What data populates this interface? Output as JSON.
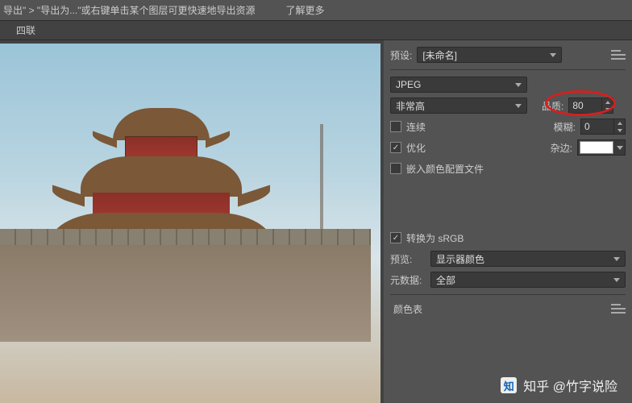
{
  "topbar": {
    "breadcrumb": "导出\" > \"导出为...\"或右键单击某个图层可更快速地导出资源",
    "learn_more": "了解更多"
  },
  "tab": {
    "label": "四联"
  },
  "panel": {
    "preset": {
      "label": "预设:",
      "value": "[未命名]"
    },
    "format": {
      "value": "JPEG"
    },
    "quality_preset": {
      "value": "非常高"
    },
    "quality": {
      "label": "品质:",
      "value": "80"
    },
    "progressive": {
      "label": "连续",
      "checked": false
    },
    "blur": {
      "label": "模糊:",
      "value": "0"
    },
    "optimized": {
      "label": "优化",
      "checked": true
    },
    "matte": {
      "label": "杂边:"
    },
    "embed_profile": {
      "label": "嵌入颜色配置文件",
      "checked": false
    },
    "convert_srgb": {
      "label": "转换为 sRGB",
      "checked": true
    },
    "preview": {
      "label": "预览:",
      "value": "显示器颜色"
    },
    "metadata": {
      "label": "元数据:",
      "value": "全部"
    },
    "color_table": {
      "label": "颜色表"
    }
  },
  "watermark": {
    "text": "知乎 @竹字说险"
  }
}
